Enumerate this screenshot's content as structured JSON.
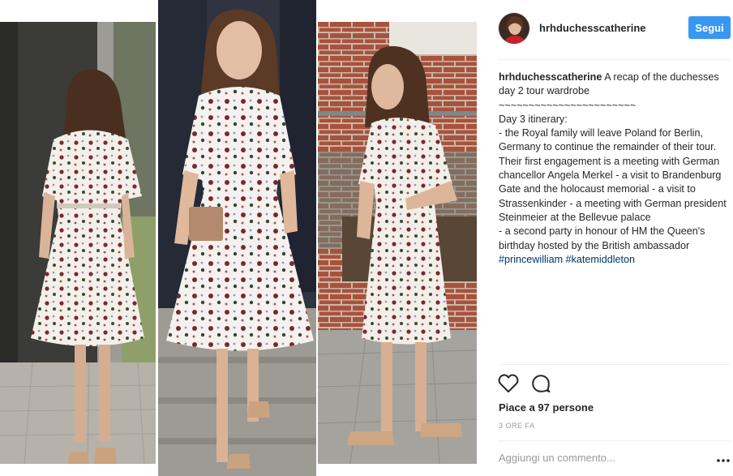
{
  "post": {
    "username": "hrhduchesscatherine",
    "follow_label": "Segui",
    "caption_username": "hrhduchesscatherine",
    "caption_text": " A recap of the duchesses day 2 tour wardrobe\n~~~~~~~~~~~~~~~~~~~~~~~\nDay 3 itinerary:\n- the Royal family will leave Poland for Berlin, Germany to continue the remainder of their tour. Their first engagement is a meeting with German chancellor Angela Merkel - a visit to Brandenburg Gate and the holocaust memorial - a visit to Strassenkinder - a meeting with German president Steinmeier at the Bellevue palace\n- a second party in honour of HM the Queen's birthday hosted by the British ambassador\n",
    "hashtags": [
      {
        "text": "#princewilliam"
      },
      {
        "text": "#katemiddleton"
      }
    ],
    "likes_label": "Piace a 97 persone",
    "timestamp": "3 ORE FA",
    "comment_placeholder": "Aggiungi un commento..."
  },
  "icons": {
    "heart": "heart-icon",
    "comment": "comment-icon",
    "more": "more-icon"
  },
  "colors": {
    "follow_button": "#3897f0",
    "hashtag": "#003569",
    "muted_text": "#999999",
    "text": "#262626"
  }
}
